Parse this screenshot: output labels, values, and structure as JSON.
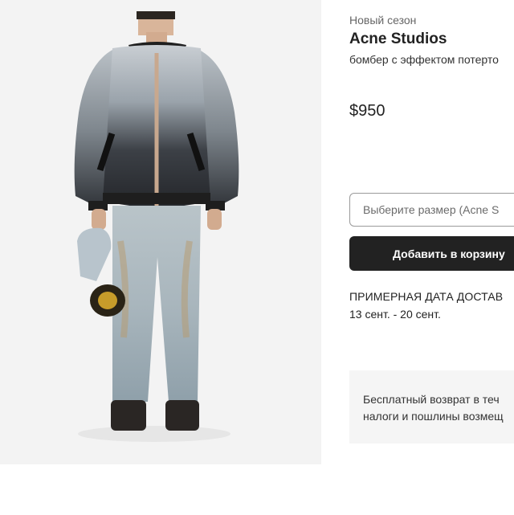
{
  "product": {
    "season": "Новый сезон",
    "brand": "Acne Studios",
    "description": "бомбер с эффектом потерто",
    "price": "$950"
  },
  "actions": {
    "size_placeholder": "Выберите размер (Acne S",
    "add_to_cart_label": "Добавить в корзину"
  },
  "delivery": {
    "title": "ПРИМЕРНАЯ ДАТА ДОСТАВ",
    "dates": "13 сент. - 20 сент."
  },
  "returns": {
    "line1": "Бесплатный возврат в теч",
    "line2": "налоги и пошлины возмещ"
  },
  "image": {
    "subject": "product-photo-model-wearing-bomber-jacket",
    "background_color": "#f3f3f3"
  }
}
